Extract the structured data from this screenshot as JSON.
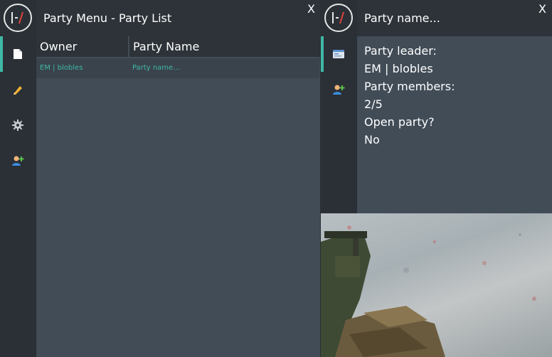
{
  "party_list_window": {
    "title": "Party Menu - Party List",
    "close_label": "X",
    "sidebar": [
      "document-icon",
      "pencil-icon",
      "gear-icon",
      "add-user-icon"
    ],
    "columns": [
      "Owner",
      "Party Name"
    ],
    "rows": [
      {
        "owner": "EM | blobles",
        "party_name": "Party name..."
      }
    ]
  },
  "party_info_window": {
    "title": "Party name...",
    "close_label": "X",
    "sidebar": [
      "id-card-icon",
      "add-user-icon"
    ],
    "leader_label": "Party leader:",
    "leader_value": "EM | blobles",
    "members_label": "Party members:",
    "members_value": "2/5",
    "open_label": "Open party?",
    "open_value": "No"
  },
  "colors": {
    "accent": "#3fb8a6",
    "panel_bg": "#414c57",
    "header_bg": "#2d3339",
    "sidebar_bg": "#2a3036"
  }
}
